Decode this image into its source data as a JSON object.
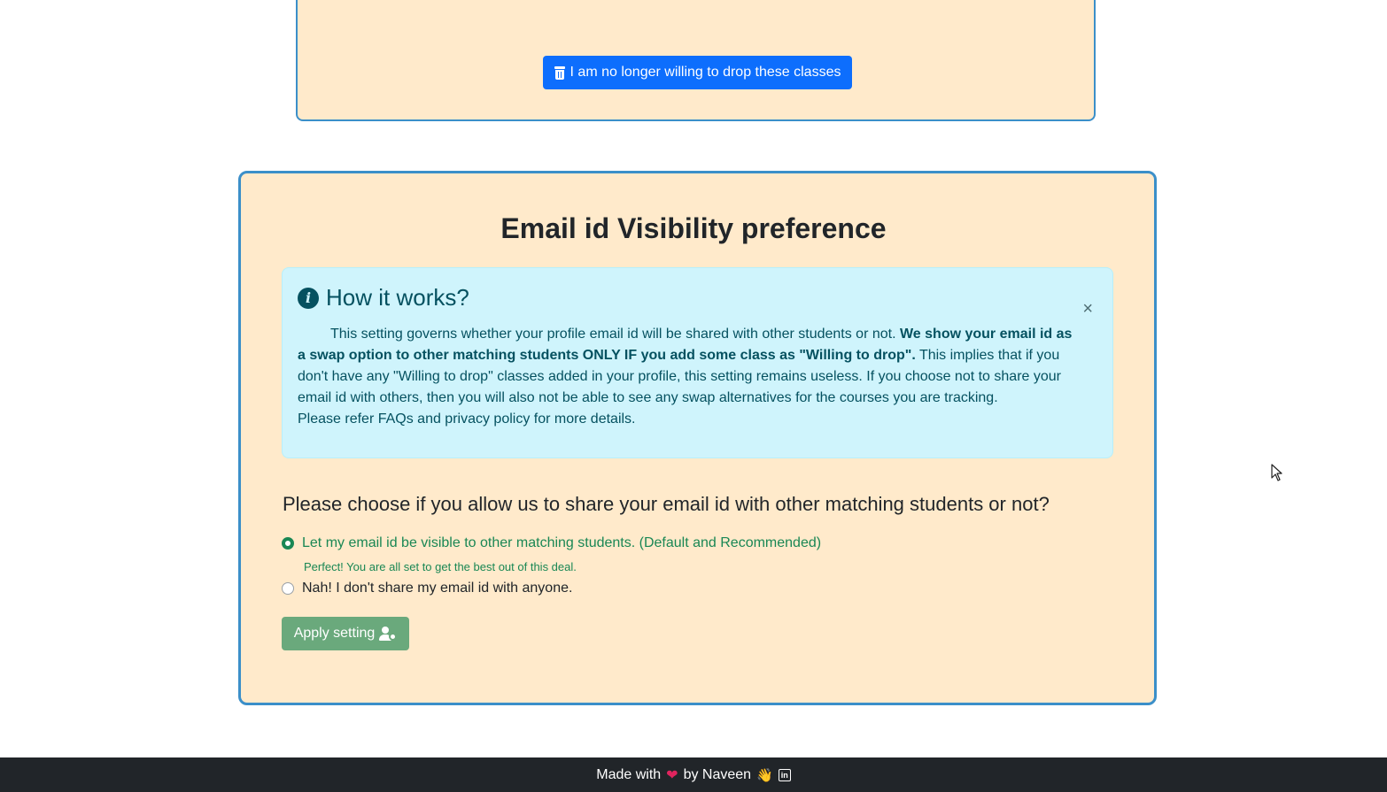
{
  "top_card": {
    "drop_button_label": "I am no longer willing to drop these classes"
  },
  "main_card": {
    "title": "Email id Visibility preference",
    "alert": {
      "title": "How it works?",
      "close_symbol": "×",
      "body_part1": "This setting governs whether your profile email id will be shared with other students or not. ",
      "body_bold": "We show your email id as a swap option to other matching students ONLY IF you add some class as \"Willing to drop\".",
      "body_part2": " This implies that if you don't have any \"Willing to drop\" classes added in your profile, this setting remains useless. If you choose not to share your email id with others, then you will also not be able to see any swap alternatives for the courses you are tracking.",
      "body_line2": "Please refer FAQs and privacy policy for more details."
    },
    "question": "Please choose if you allow us to share your email id with other matching students or not?",
    "options": [
      {
        "label": "Let my email id be visible to other matching students. (Default and Recommended)",
        "checked": true
      },
      {
        "label": "Nah! I don't share my email id with anyone.",
        "checked": false
      }
    ],
    "selected_hint": "Perfect! You are all set to get the best out of this deal.",
    "apply_button_label": "Apply setting"
  },
  "footer": {
    "made_with": "Made with",
    "heart": "❤",
    "by": "by Naveen",
    "wave": "👋",
    "linkedin": "in"
  },
  "colors": {
    "card_bg": "#ffeacb",
    "card_border": "#3b8fc9",
    "primary": "#0d6efd",
    "success": "#198754",
    "info_bg": "#cff4fc",
    "footer_bg": "#212529"
  }
}
